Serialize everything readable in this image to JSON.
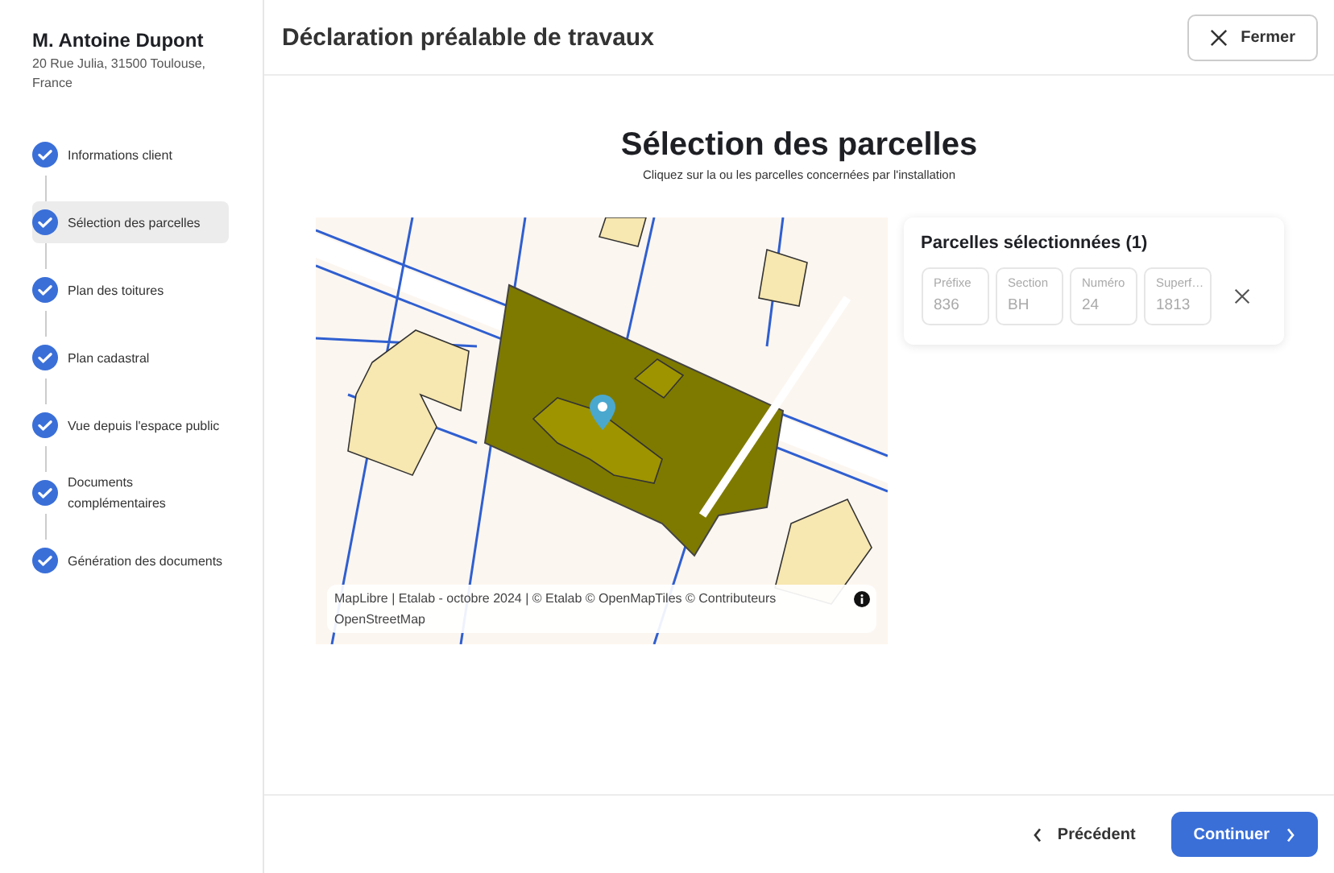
{
  "client": {
    "name": "M. Antoine Dupont",
    "address": "20 Rue Julia, 31500 Toulouse, France"
  },
  "steps": [
    {
      "label": "Informations client",
      "done": true,
      "selected": false
    },
    {
      "label": "Sélection des parcelles",
      "done": true,
      "selected": true
    },
    {
      "label": "Plan des toitures",
      "done": true,
      "selected": false
    },
    {
      "label": "Plan cadastral",
      "done": true,
      "selected": false
    },
    {
      "label": "Vue depuis l'espace public",
      "done": true,
      "selected": false
    },
    {
      "label": "Documents complémentaires",
      "done": true,
      "selected": false
    },
    {
      "label": "Génération des documents",
      "done": true,
      "selected": false
    }
  ],
  "header": {
    "title": "Déclaration préalable de travaux",
    "close_button": "Fermer"
  },
  "page": {
    "title": "Sélection des parcelles",
    "subtitle": "Cliquez sur la ou les parcelles concernées par l'installation"
  },
  "map": {
    "attribution": "MapLibre | Etalab - octobre 2024 | © Etalab © OpenMapTiles © Contributeurs OpenStreetMap"
  },
  "selected_parcels": {
    "title": "Parcelles sélectionnées (1)",
    "parcels": [
      {
        "fields": [
          {
            "label": "Préfixe",
            "value": "836"
          },
          {
            "label": "Section",
            "value": "BH"
          },
          {
            "label": "Numéro",
            "value": "24"
          },
          {
            "label": "Superf…",
            "value": "1813"
          }
        ]
      }
    ]
  },
  "footer": {
    "back_button": "Précédent",
    "next_button": "Continuer"
  }
}
